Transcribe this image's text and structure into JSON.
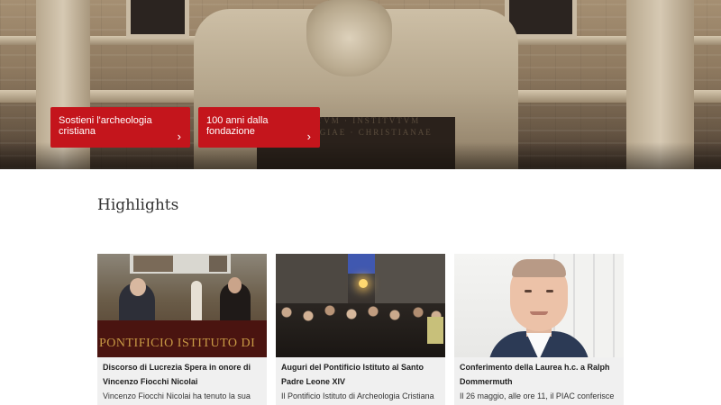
{
  "hero": {
    "inscription_line1": "CTVM · INSTITVTVM",
    "inscription_line2": "OLOGIAE · CHRISTIANAE"
  },
  "cta_buttons": [
    {
      "label": "Sostieni l'archeologia cristiana",
      "icon": "chevron-right-icon"
    },
    {
      "label": "100 anni dalla fondazione",
      "icon": "chevron-right-icon"
    }
  ],
  "highlights": {
    "title": "Highlights",
    "cards": [
      {
        "title": "Discorso di Lucrezia Spera in onore di Vincenzo Fiocchi Nicolai",
        "excerpt": "Vincenzo Fiocchi Nicolai ha tenuto la sua",
        "photo_text": "PONTIFICIO ISTITUTO DI"
      },
      {
        "title": "Auguri del Pontificio Istituto al Santo Padre Leone XIV",
        "excerpt": "Il Pontificio Istituto di Archeologia Cristiana"
      },
      {
        "title": "Conferimento della Laurea h.c. a Ralph Dommermuth",
        "excerpt": "Il 26 maggio, alle ore 11, il PIAC conferisce"
      }
    ]
  },
  "colors": {
    "accent": "#c4151c",
    "card_bg": "#f0f0f0"
  }
}
